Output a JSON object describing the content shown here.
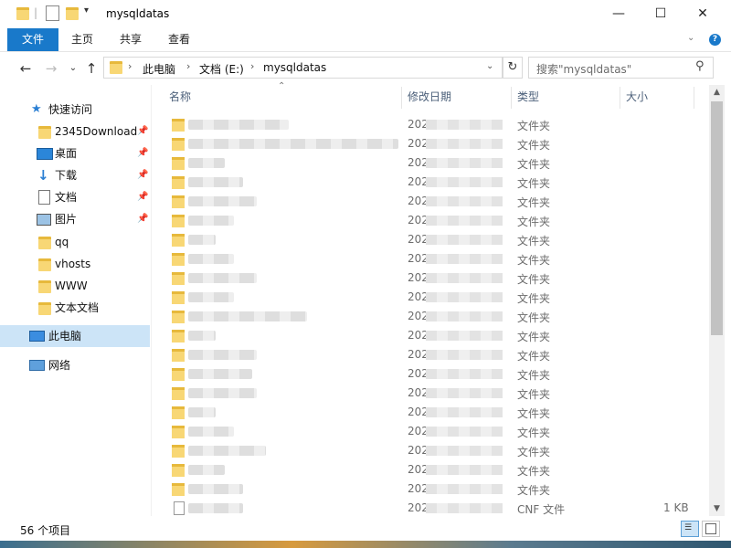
{
  "window": {
    "title": "mysqldatas",
    "minimize": "—",
    "maximize": "☐",
    "close": "✕"
  },
  "ribbon": {
    "tabs": [
      "文件",
      "主页",
      "共享",
      "查看"
    ],
    "help": "?"
  },
  "address": {
    "crumbs": [
      "此电脑",
      "文档 (E:)",
      "mysqldatas"
    ],
    "search_placeholder": "搜索\"mysqldatas\""
  },
  "sidebar": {
    "quick_access": "快速访问",
    "items": [
      {
        "label": "2345Download",
        "pinned": true,
        "icon": "folder-icon"
      },
      {
        "label": "桌面",
        "pinned": true,
        "icon": "desktop-icon"
      },
      {
        "label": "下载",
        "pinned": true,
        "icon": "download-icon"
      },
      {
        "label": "文档",
        "pinned": true,
        "icon": "document-icon"
      },
      {
        "label": "图片",
        "pinned": true,
        "icon": "picture-icon"
      },
      {
        "label": "qq",
        "pinned": false,
        "icon": "folder-icon"
      },
      {
        "label": "vhosts",
        "pinned": false,
        "icon": "folder-icon"
      },
      {
        "label": "WWW",
        "pinned": false,
        "icon": "folder-icon"
      },
      {
        "label": "文本文档",
        "pinned": false,
        "icon": "folder-icon"
      }
    ],
    "this_pc": "此电脑",
    "network": "网络"
  },
  "columns": {
    "name": "名称",
    "date": "修改日期",
    "type": "类型",
    "size": "大小"
  },
  "rows": [
    {
      "date": "202",
      "type": "文件夹",
      "size": ""
    },
    {
      "date": "202",
      "type": "文件夹",
      "size": ""
    },
    {
      "date": "202",
      "type": "文件夹",
      "size": ""
    },
    {
      "date": "202",
      "type": "文件夹",
      "size": ""
    },
    {
      "date": "202",
      "type": "文件夹",
      "size": ""
    },
    {
      "date": "202",
      "type": "文件夹",
      "size": ""
    },
    {
      "date": "202",
      "type": "文件夹",
      "size": ""
    },
    {
      "date": "202",
      "type": "文件夹",
      "size": ""
    },
    {
      "date": "202",
      "type": "文件夹",
      "size": ""
    },
    {
      "date": "202",
      "type": "文件夹",
      "size": ""
    },
    {
      "date": "202",
      "type": "文件夹",
      "size": ""
    },
    {
      "date": "202",
      "type": "文件夹",
      "size": ""
    },
    {
      "date": "202",
      "type": "文件夹",
      "size": ""
    },
    {
      "date": "202",
      "type": "文件夹",
      "size": ""
    },
    {
      "date": "202",
      "type": "文件夹",
      "size": ""
    },
    {
      "date": "202",
      "type": "文件夹",
      "size": ""
    },
    {
      "date": "202",
      "type": "文件夹",
      "size": ""
    },
    {
      "date": "202",
      "type": "文件夹",
      "size": ""
    },
    {
      "date": "202",
      "type": "文件夹",
      "size": ""
    },
    {
      "date": "202",
      "type": "文件夹",
      "size": ""
    },
    {
      "date": "2020",
      "type": "CNF 文件",
      "size": "1 KB"
    }
  ],
  "status": {
    "count": "56 个项目"
  },
  "colors": {
    "accent": "#1979ca",
    "selection": "#cce4f7",
    "folder": "#f8d775"
  }
}
